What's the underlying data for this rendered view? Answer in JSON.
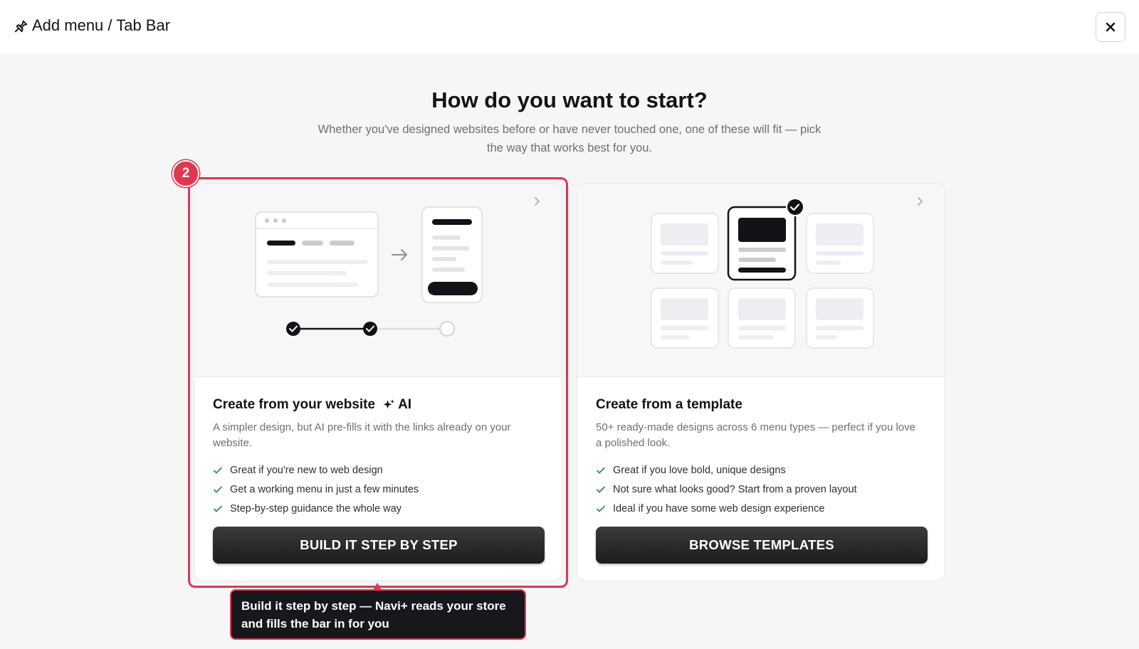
{
  "header": {
    "title": "Add menu / Tab Bar",
    "icon": "pin-icon",
    "close_icon": "close-icon"
  },
  "main": {
    "heading": "How do you want to start?",
    "subheading": "Whether you've designed websites before or have never touched one, one of these will fit — pick the way that works best for you."
  },
  "cards": [
    {
      "title": "Create from your website",
      "ai_label": "AI",
      "description": "A simpler design, but AI pre-fills it with the links already on your website.",
      "bullets": [
        "Great if you're new to web design",
        "Get a working menu in just a few minutes",
        "Step-by-step guidance the whole way"
      ],
      "button_label": "BUILD IT STEP BY STEP"
    },
    {
      "title": "Create from a template",
      "description": "50+ ready-made designs across 6 menu types — perfect if you love a polished look.",
      "bullets": [
        "Great if you love bold, unique designs",
        "Not sure what looks good? Start from a proven layout",
        "Ideal if you have some web design experience"
      ],
      "button_label": "BROWSE TEMPLATES"
    }
  ],
  "guide": {
    "step_number": "2",
    "tooltip": "Build it step by step — Navi+ reads your store and fills the bar in for you",
    "accent_color": "#e2364f"
  },
  "colors": {
    "background": "#f6f6f7",
    "text": "#111318",
    "muted": "#6b6f78",
    "button": "#1c1c1e"
  }
}
